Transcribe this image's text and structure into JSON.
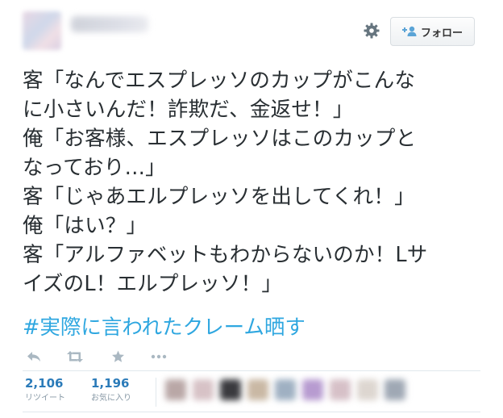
{
  "header": {
    "follow_label": "フォロー",
    "settings_icon": "gear-icon",
    "follow_icon": "person-plus-icon"
  },
  "tweet": {
    "lines": [
      "客「なんでエスプレッソのカップがこんな",
      "に小さいんだ！詐欺だ、金返せ！」",
      "俺「お客様、エスプレッソはこのカップと",
      "なっており…」",
      "客「じゃあエルプレッソを出してくれ！」",
      "俺「はい？」",
      "客「アルファベットもわからないのか！Lサ",
      "イズのL！エルプレッソ！」"
    ],
    "hashtag": "#実際に言われたクレーム晒す"
  },
  "actions": {
    "icons": [
      "reply-icon",
      "retweet-icon",
      "favorite-icon",
      "more-icon"
    ]
  },
  "stats": {
    "retweets": {
      "count": "2,106",
      "label": "リツイート"
    },
    "favorites": {
      "count": "1,196",
      "label": "お気に入り"
    }
  },
  "colors": {
    "text": "#292f33",
    "hashtag": "#2fa7e0",
    "stat_number": "#2b7bb9",
    "muted": "#8899a6",
    "icon": "#aab8c2",
    "divider": "#e1e8ed"
  }
}
